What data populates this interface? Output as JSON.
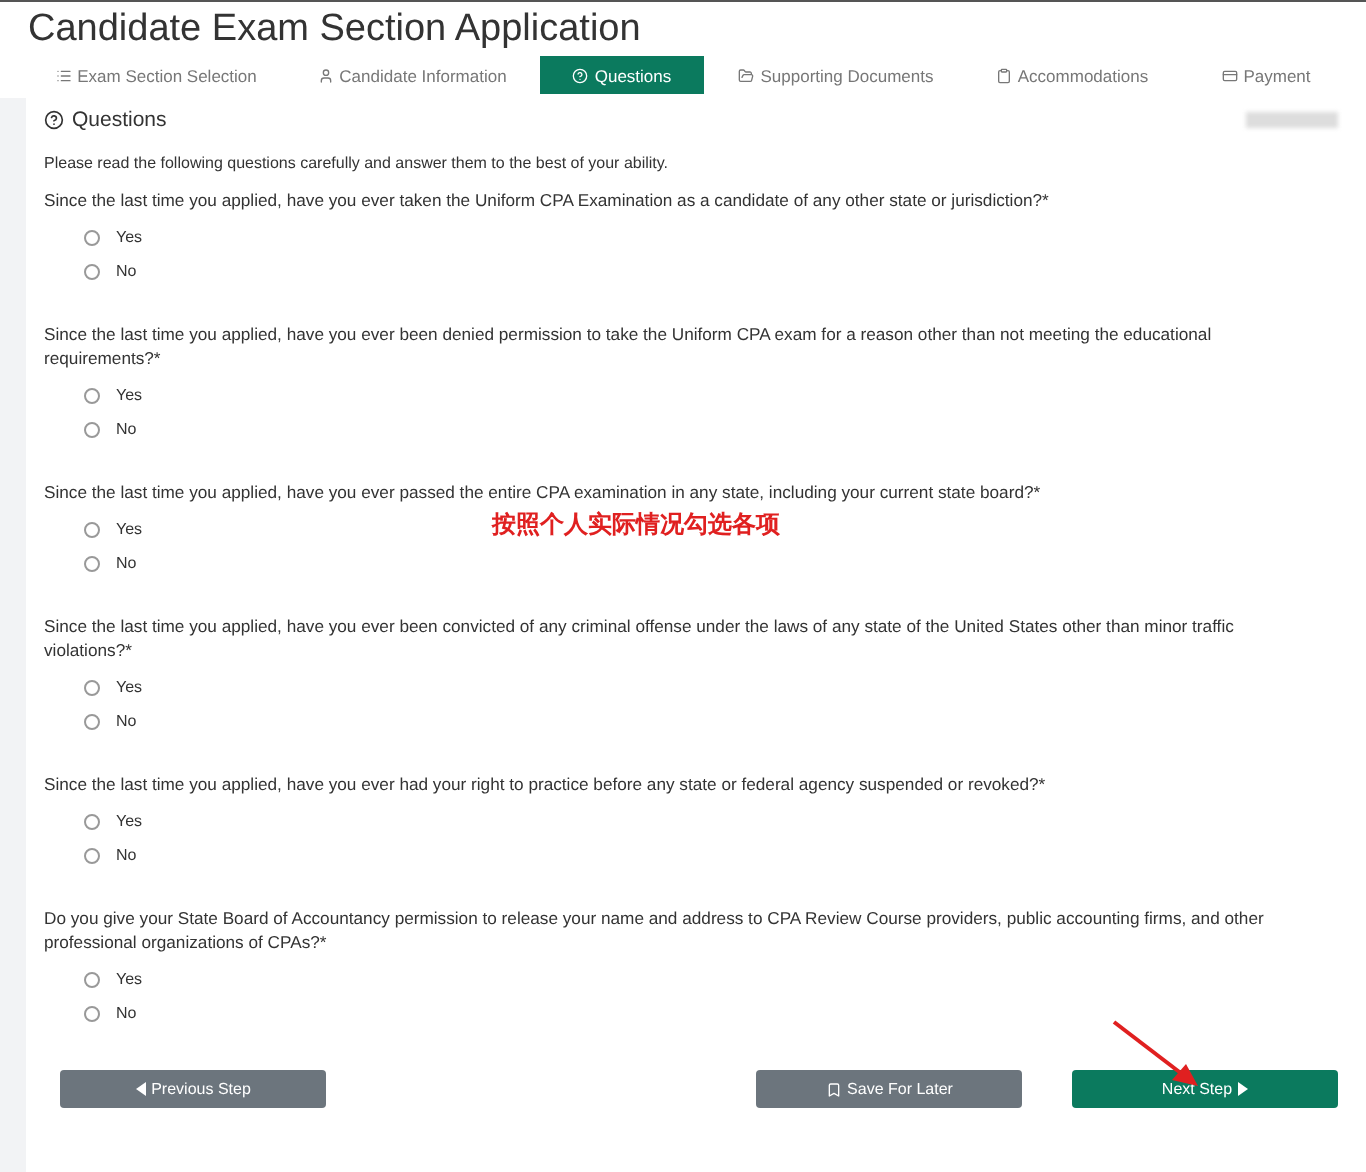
{
  "title": "Candidate Exam Section Application",
  "tabs": [
    {
      "label": "Exam Section Selection",
      "kind": "list",
      "selected": false
    },
    {
      "label": "Candidate Information",
      "kind": "user",
      "selected": false
    },
    {
      "label": "Questions",
      "kind": "help",
      "selected": true
    },
    {
      "label": "Supporting Documents",
      "kind": "folder",
      "selected": false
    },
    {
      "label": "Accommodations",
      "kind": "clipboard",
      "selected": false
    },
    {
      "label": "Payment",
      "kind": "card",
      "selected": false
    }
  ],
  "section": {
    "heading": "Questions",
    "intro": "Please read the following questions carefully and answer them to the best of your ability."
  },
  "questions": [
    {
      "text": "Since the last time you applied, have you ever taken the Uniform CPA Examination as a candidate of any other state or jurisdiction?*",
      "options": [
        {
          "label": "Yes",
          "selected": false
        },
        {
          "label": "No",
          "selected": false
        }
      ]
    },
    {
      "text": "Since the last time you applied, have you ever been denied permission to take the Uniform CPA exam for a reason other than not meeting the educational requirements?*",
      "options": [
        {
          "label": "Yes",
          "selected": false
        },
        {
          "label": "No",
          "selected": false
        }
      ]
    },
    {
      "text": "Since the last time you applied, have you ever passed the entire CPA examination in any state, including your current state board?*",
      "options": [
        {
          "label": "Yes",
          "selected": false
        },
        {
          "label": "No",
          "selected": false
        }
      ]
    },
    {
      "text": "Since the last time you applied, have you ever been convicted of any criminal offense under the laws of any state of the United States other than minor traffic violations?*",
      "options": [
        {
          "label": "Yes",
          "selected": false
        },
        {
          "label": "No",
          "selected": false
        }
      ]
    },
    {
      "text": "Since the last time you applied, have you ever had your right to practice before any state or federal agency suspended or revoked?*",
      "options": [
        {
          "label": "Yes",
          "selected": false
        },
        {
          "label": "No",
          "selected": false
        }
      ]
    },
    {
      "text": "Do you give your State Board of Accountancy permission to release your name and address to CPA Review Course providers, public accounting firms, and other professional organizations of CPAs?*",
      "options": [
        {
          "label": "Yes",
          "selected": false
        },
        {
          "label": "No",
          "selected": false
        }
      ]
    }
  ],
  "buttons": [
    {
      "label": "Previous Step",
      "kind": "previous"
    },
    {
      "label": "Save For Later",
      "kind": "save"
    },
    {
      "label": "Next Step",
      "kind": "next"
    }
  ],
  "annotation": "按照个人实际情况勾选各项"
}
